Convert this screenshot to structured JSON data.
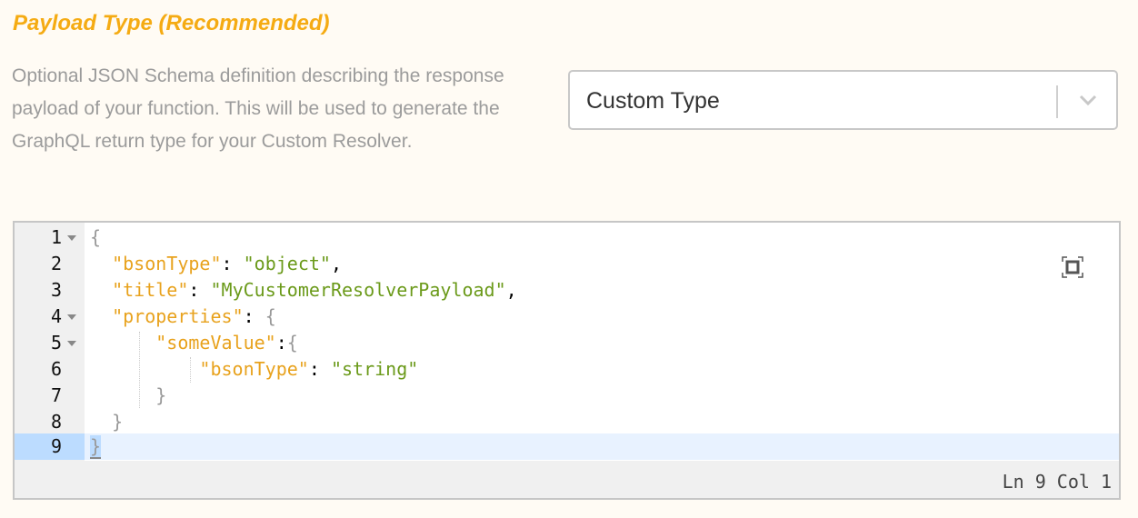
{
  "section": {
    "title": "Payload Type (Recommended)",
    "description": "Optional JSON Schema definition describing the response payload of your function. This will be used to generate the GraphQL return type for your Custom Resolver."
  },
  "payload_type_select": {
    "selected": "Custom Type",
    "icon": "chevron-down-icon"
  },
  "editor": {
    "lines": [
      {
        "num": "1",
        "foldable": true
      },
      {
        "num": "2",
        "foldable": false
      },
      {
        "num": "3",
        "foldable": false
      },
      {
        "num": "4",
        "foldable": true
      },
      {
        "num": "5",
        "foldable": true
      },
      {
        "num": "6",
        "foldable": false
      },
      {
        "num": "7",
        "foldable": false
      },
      {
        "num": "8",
        "foldable": false
      },
      {
        "num": "9",
        "foldable": false,
        "active": true
      }
    ],
    "tokens": {
      "l1_open": "{",
      "l2_key": "bsonType",
      "l2_val": "object",
      "l3_key": "title",
      "l3_val": "MyCustomerResolverPayload",
      "l4_key": "properties",
      "l4_open": "{",
      "l5_key": "someValue",
      "l5_open": "{",
      "l6_key": "bsonType",
      "l6_val": "string",
      "l7_close": "}",
      "l8_close": "}",
      "l9_close": "}"
    },
    "status": "Ln 9 Col 1",
    "fullscreen_icon": "fullscreen-icon"
  },
  "colors": {
    "title": "#f5ab13",
    "json_key": "#e8a21d",
    "json_string": "#6b9a1a",
    "active_line": "#e8f2ff",
    "active_gutter": "#bcdcff"
  }
}
